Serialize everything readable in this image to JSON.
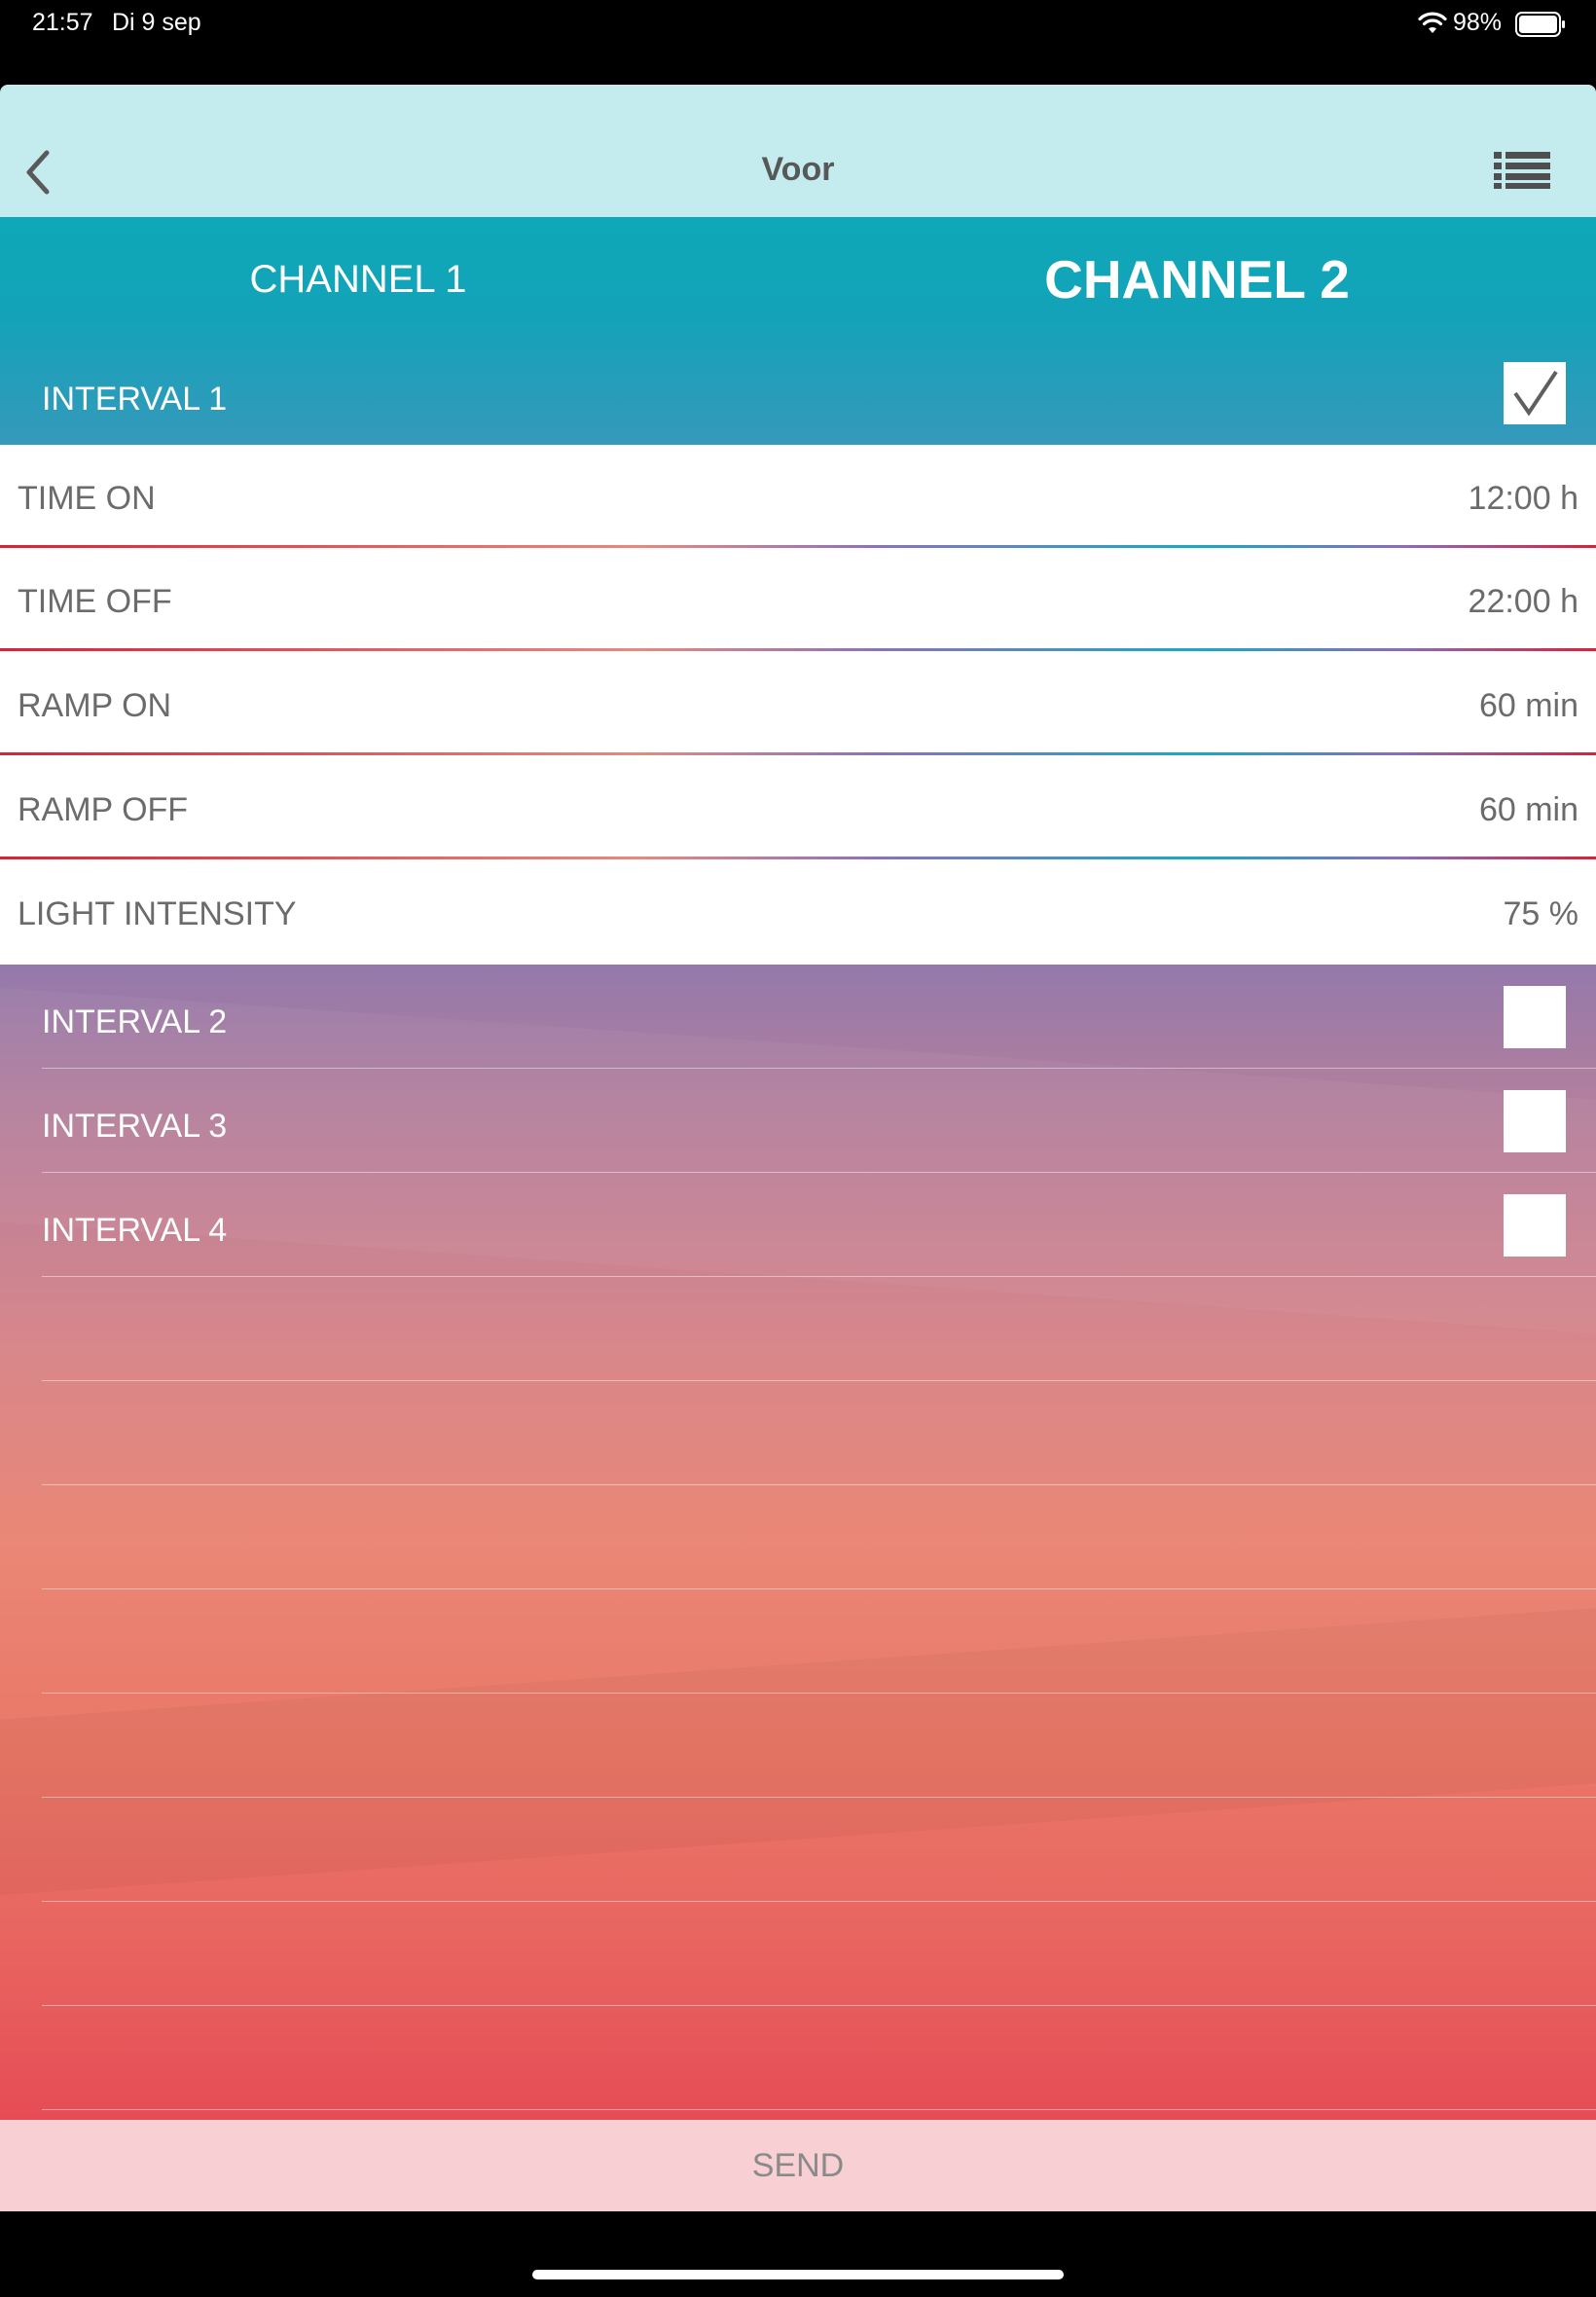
{
  "status_bar": {
    "time": "21:57",
    "date": "Di 9 sep",
    "battery_percent": "98%",
    "icons": [
      "wifi-icon",
      "battery-icon"
    ]
  },
  "nav": {
    "title": "Voor",
    "back_icon": "chevron-left-icon",
    "menu_icon": "list-icon"
  },
  "channels": {
    "tabs": [
      {
        "label": "CHANNEL 1",
        "selected": false
      },
      {
        "label": "CHANNEL 2",
        "selected": true
      }
    ]
  },
  "interval_1": {
    "label": "INTERVAL 1",
    "checked": true,
    "settings": [
      {
        "label": "TIME ON",
        "value": "12:00 h"
      },
      {
        "label": "TIME OFF",
        "value": "22:00 h"
      },
      {
        "label": "RAMP ON",
        "value": "60 min"
      },
      {
        "label": "RAMP OFF",
        "value": "60 min"
      },
      {
        "label": "LIGHT INTENSITY",
        "value": "75 %"
      }
    ]
  },
  "intervals": [
    {
      "label": "INTERVAL 2",
      "checked": false
    },
    {
      "label": "INTERVAL 3",
      "checked": false
    },
    {
      "label": "INTERVAL 4",
      "checked": false
    }
  ],
  "send_button": {
    "label": "SEND"
  },
  "colors": {
    "nav_bg": "#c4ecef",
    "channel_bg": "#0ea8b8",
    "send_bg": "#f8cfd2",
    "gradient_top": "#9479ab",
    "gradient_bottom": "#e64c55"
  }
}
